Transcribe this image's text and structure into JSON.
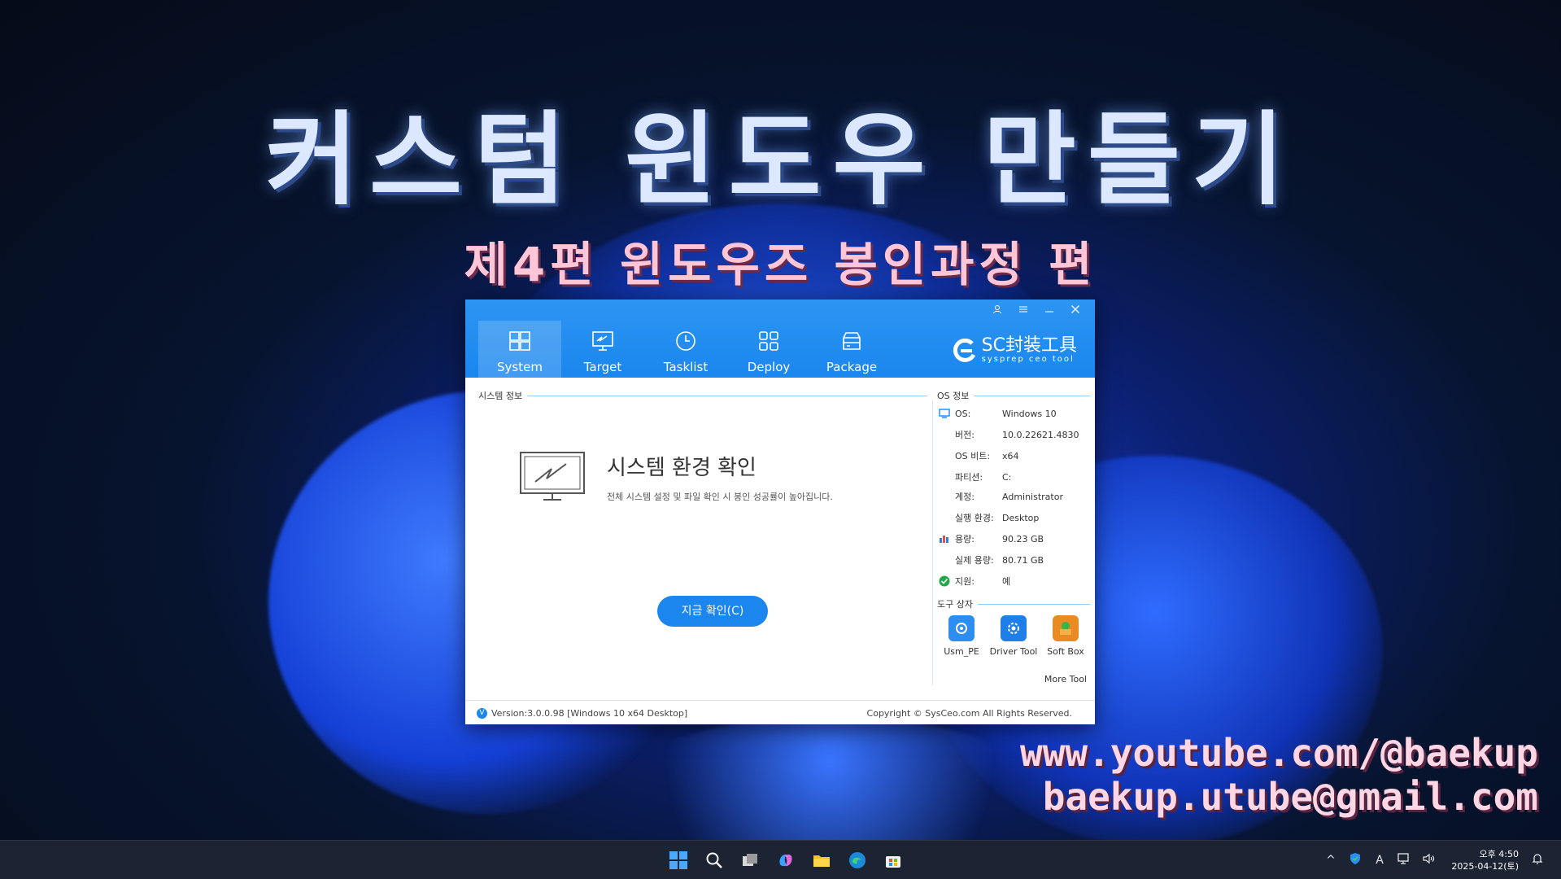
{
  "overlay": {
    "title": "커스텀 윈도우 만들기",
    "subtitle": "제4편 윈도우즈 봉인과정 편",
    "youtube": "www.youtube.com/@baekup",
    "email": "baekup.utube@gmail.com"
  },
  "app": {
    "nav": [
      {
        "label": "System",
        "icon": "windows-icon"
      },
      {
        "label": "Target",
        "icon": "monitor-icon"
      },
      {
        "label": "Tasklist",
        "icon": "clock-icon"
      },
      {
        "label": "Deploy",
        "icon": "grid-icon"
      },
      {
        "label": "Package",
        "icon": "box-icon"
      }
    ],
    "brand": {
      "name": "SC封装工具",
      "sub": "sysprep ceo tool"
    },
    "system_section_label": "시스템 정보",
    "main_title": "시스템 환경 확인",
    "main_desc": "전체 시스템 설정 및 파일 확인 시 봉인 성공률이 높아집니다.",
    "check_button": "지금 확인(C)",
    "os_section_label": "OS 정보",
    "os_info": [
      {
        "key": "OS:",
        "value": "Windows 10"
      },
      {
        "key": "버전:",
        "value": "10.0.22621.4830"
      },
      {
        "key": "OS 비트:",
        "value": "x64"
      },
      {
        "key": "파티션:",
        "value": "C:"
      },
      {
        "key": "계정:",
        "value": "Administrator"
      },
      {
        "key": "실행 환경:",
        "value": "Desktop"
      },
      {
        "key": "용량:",
        "value": "90.23 GB"
      },
      {
        "key": "실제 용량:",
        "value": "80.71 GB"
      },
      {
        "key": "지원:",
        "value": "예"
      }
    ],
    "tools_section_label": "도구 상자",
    "tools": [
      {
        "label": "Usm_PE",
        "color": "#2b8ef0"
      },
      {
        "label": "Driver Tool",
        "color": "#1e7fe8"
      },
      {
        "label": "Soft Box",
        "color": "#e98a22"
      }
    ],
    "more_tool": "More Tool",
    "version": "Version:3.0.0.98 [Windows 10 x64 Desktop]",
    "copyright": "Copyright © SysCeo.com All Rights Reserved."
  },
  "taskbar": {
    "time": "오후 4:50",
    "date": "2025-04-12(토)",
    "ime": "A"
  }
}
